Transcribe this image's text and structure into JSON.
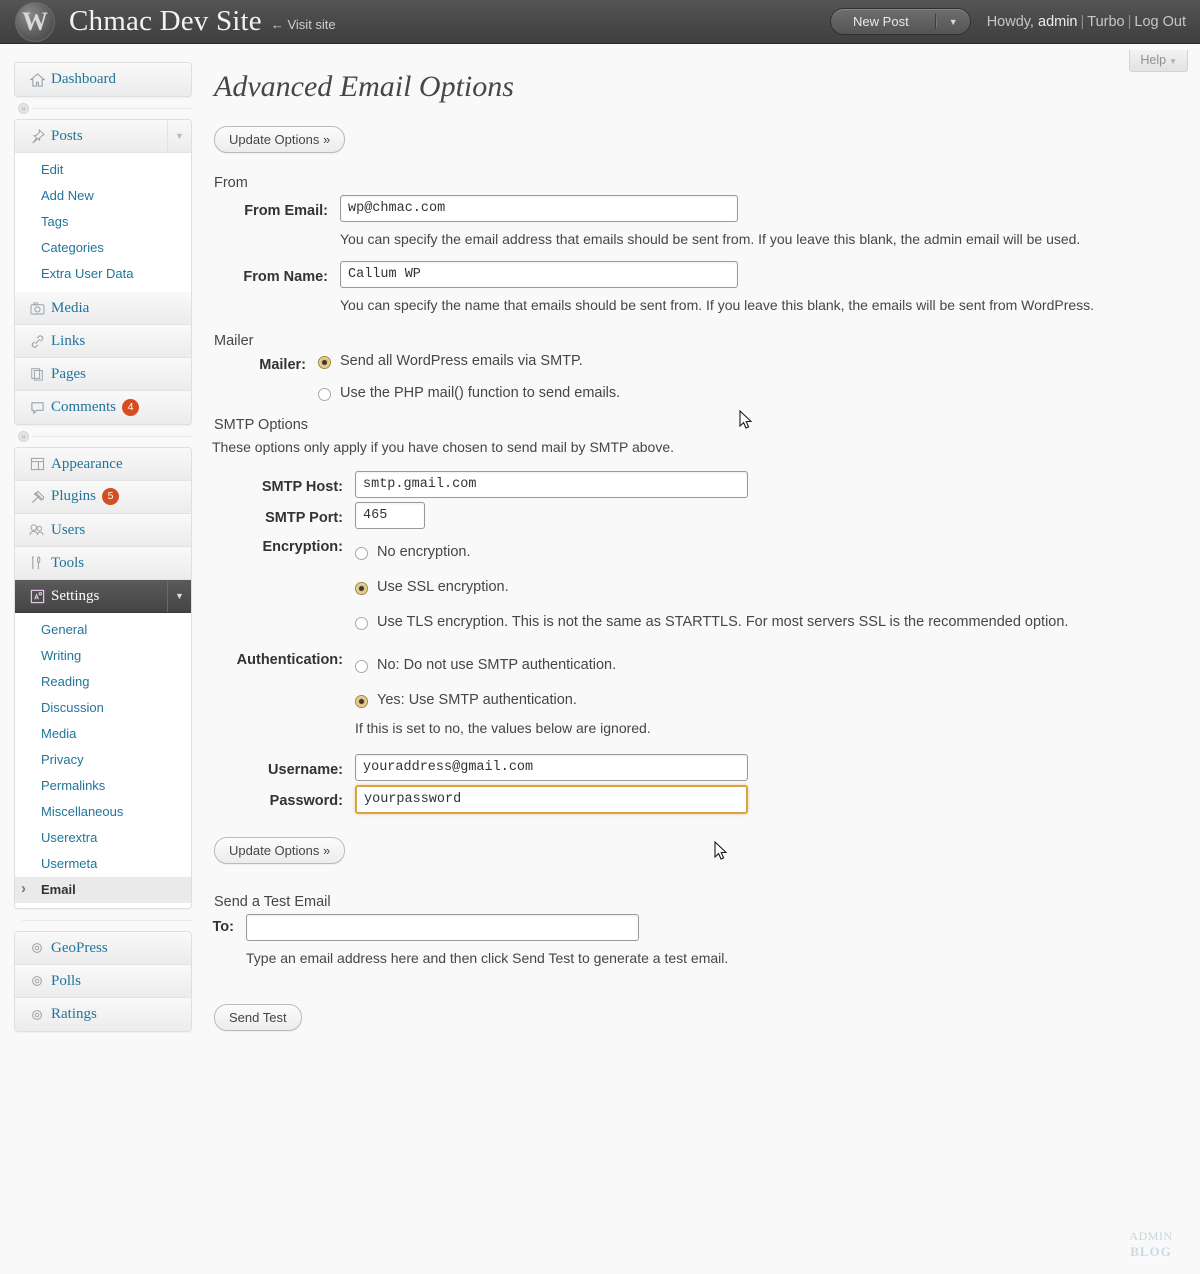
{
  "adminbar": {
    "site_title": "Chmac Dev Site",
    "visit_site": "← Visit site",
    "new_post_label": "New Post",
    "new_post_caret": "▼",
    "howdy_prefix": "Howdy, ",
    "howdy_user": "admin",
    "turbo": "Turbo",
    "logout": "Log Out",
    "separator": "|"
  },
  "sidebar": {
    "dashboard": {
      "label": "Dashboard",
      "icon": "home-icon"
    },
    "posts": {
      "label": "Posts",
      "icon": "pin-icon",
      "toggle": "▼",
      "items": [
        {
          "label": "Edit"
        },
        {
          "label": "Add New"
        },
        {
          "label": "Tags"
        },
        {
          "label": "Categories"
        },
        {
          "label": "Extra User Data"
        }
      ]
    },
    "media": {
      "label": "Media",
      "icon": "camera-icon"
    },
    "links": {
      "label": "Links",
      "icon": "link-icon"
    },
    "pages": {
      "label": "Pages",
      "icon": "pages-icon"
    },
    "comments": {
      "label": "Comments",
      "icon": "comment-icon",
      "badge": "4"
    },
    "appearance": {
      "label": "Appearance",
      "icon": "layout-icon"
    },
    "plugins": {
      "label": "Plugins",
      "icon": "plug-icon",
      "badge": "5"
    },
    "users": {
      "label": "Users",
      "icon": "users-icon"
    },
    "tools": {
      "label": "Tools",
      "icon": "tools-icon"
    },
    "settings": {
      "label": "Settings",
      "icon": "settings-icon",
      "toggle": "▼",
      "items": [
        {
          "label": "General"
        },
        {
          "label": "Writing"
        },
        {
          "label": "Reading"
        },
        {
          "label": "Discussion"
        },
        {
          "label": "Media"
        },
        {
          "label": "Privacy"
        },
        {
          "label": "Permalinks"
        },
        {
          "label": "Miscellaneous"
        },
        {
          "label": "Userextra"
        },
        {
          "label": "Usermeta"
        },
        {
          "label": "Email"
        }
      ],
      "current_item": "Email"
    },
    "geopress": {
      "label": "GeoPress",
      "icon": "gear-icon"
    },
    "polls": {
      "label": "Polls",
      "icon": "gear-icon"
    },
    "ratings": {
      "label": "Ratings",
      "icon": "gear-icon"
    }
  },
  "help": {
    "label": "Help",
    "caret": "▼"
  },
  "main": {
    "page_title": "Advanced Email Options",
    "update_options_top": "Update Options »",
    "update_options_bottom": "Update Options »",
    "from_section": {
      "heading": "From",
      "email_label": "From Email:",
      "email_value": "wp@chmac.com",
      "email_hint": "You can specify the email address that emails should be sent from. If you leave this blank, the admin email will be used.",
      "name_label": "From Name:",
      "name_value": "Callum WP",
      "name_hint": "You can specify the name that emails should be sent from. If you leave this blank, the emails will be sent from WordPress."
    },
    "mailer_section": {
      "heading": "Mailer",
      "label": "Mailer:",
      "options": [
        {
          "label": "Send all WordPress emails via SMTP.",
          "selected": true
        },
        {
          "label": "Use the PHP mail() function to send emails.",
          "selected": false
        }
      ]
    },
    "smtp_section": {
      "heading": "SMTP Options",
      "intro": "These options only apply if you have chosen to send mail by SMTP above.",
      "host_label": "SMTP Host:",
      "host_value": "smtp.gmail.com",
      "port_label": "SMTP Port:",
      "port_value": "465",
      "encryption_label": "Encryption:",
      "encryption_options": [
        {
          "label": "No encryption.",
          "selected": false
        },
        {
          "label": "Use SSL encryption.",
          "selected": true
        },
        {
          "label": "Use TLS encryption. This is not the same as STARTTLS. For most servers SSL is the recommended option.",
          "selected": false
        }
      ],
      "auth_label": "Authentication:",
      "auth_options": [
        {
          "label": "No: Do not use SMTP authentication.",
          "selected": false
        },
        {
          "label": "Yes: Use SMTP authentication.",
          "selected": true
        }
      ],
      "auth_hint": "If this is set to no, the values below are ignored.",
      "username_label": "Username:",
      "username_value": "youraddress@gmail.com",
      "password_label": "Password:",
      "password_value": "yourpassword"
    },
    "test_section": {
      "heading": "Send a Test Email",
      "to_label": "To:",
      "to_value": "",
      "to_hint": "Type an email address here and then click Send Test to generate a test email.",
      "send_test_label": "Send Test"
    }
  },
  "watermark": {
    "line1": "ADMIN",
    "line2": "BLOG"
  },
  "colors": {
    "adminbar_bg": "#464646",
    "link_blue": "#21759b",
    "badge_orange": "#d54e21",
    "focus_orange": "#d9a343",
    "page_bg": "#f9f9f9"
  }
}
